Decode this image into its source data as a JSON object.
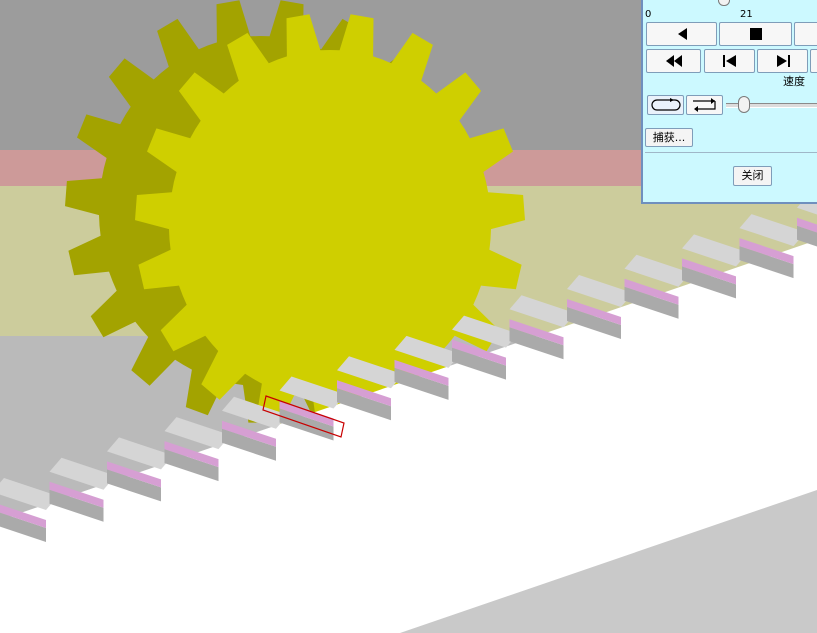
{
  "timeline": {
    "start_label": "0",
    "current_label": "21"
  },
  "speed": {
    "label": "速度"
  },
  "capture": {
    "label": "捕获..."
  },
  "close": {
    "label": "关闭"
  },
  "colors": {
    "gear_face": "#cfcf00",
    "gear_side": "#a3a300",
    "rack_top": "#d5d5d5",
    "rack_stripe": "#d69fd3",
    "rack_face": "#ffffff",
    "wall": "#9c9c9c",
    "floor": "#cccc9c",
    "wall_band": "#cd9a99",
    "panel_bg": "#ccf9ff",
    "selection_box": "#c80000"
  },
  "icons": [
    "play-reverse-icon",
    "stop-icon",
    "rewind-icon",
    "step-back-icon",
    "step-forward-icon",
    "loop-icon",
    "ping-pong-icon"
  ]
}
